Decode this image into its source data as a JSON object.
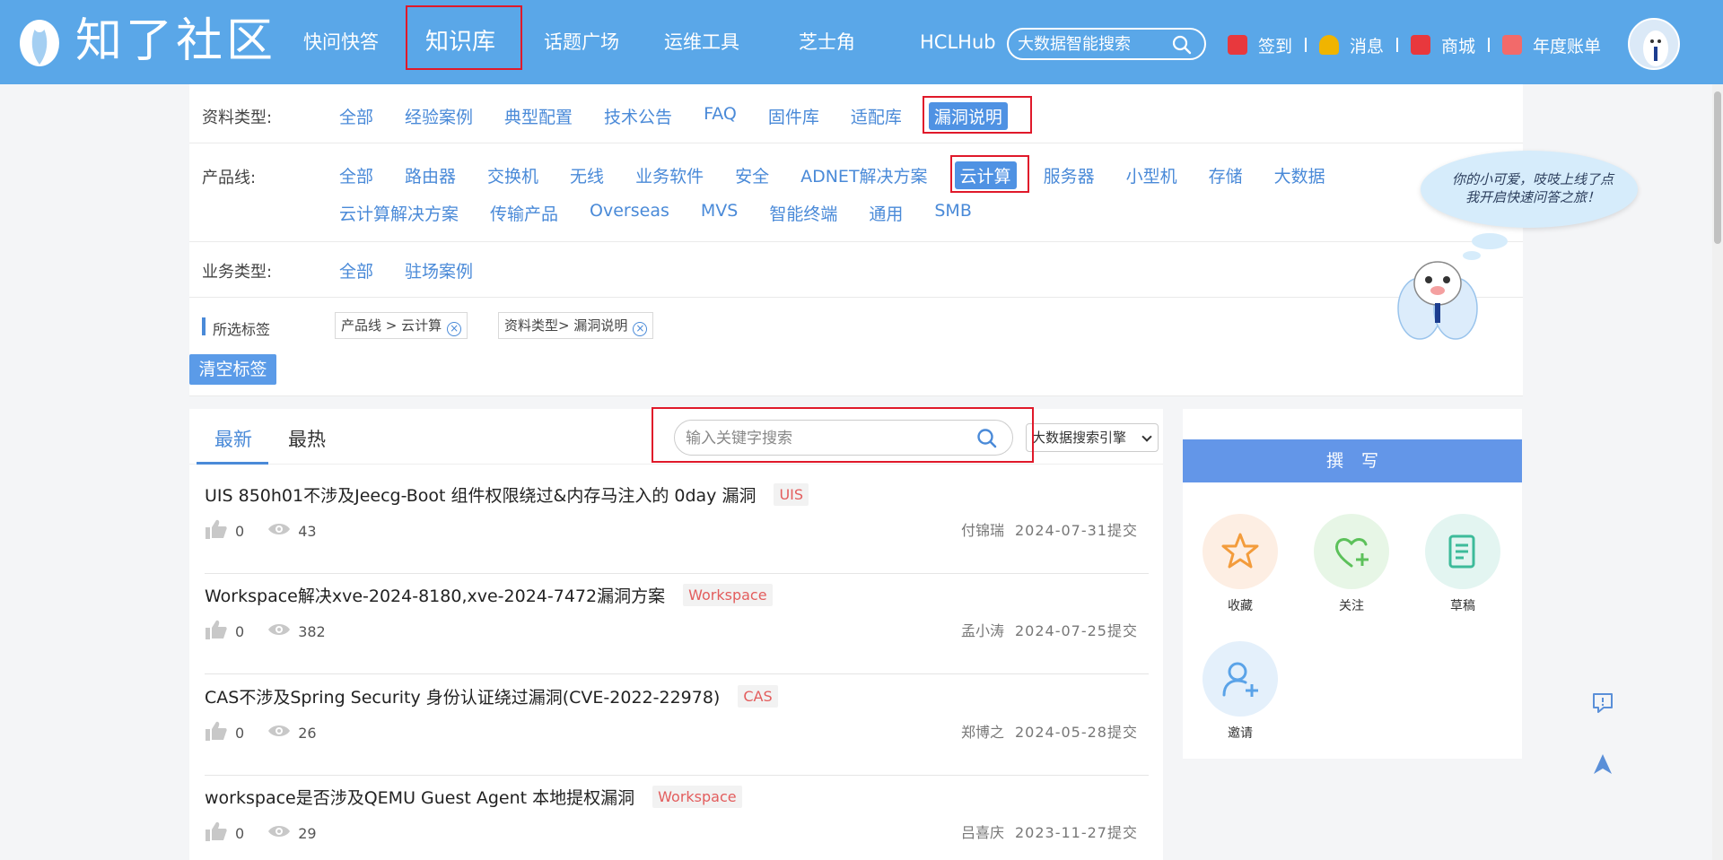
{
  "header": {
    "logo_text": "知了社区",
    "nav": [
      "快问快答",
      "知识库",
      "话题广场",
      "运维工具",
      "芝士角",
      "HCLHub"
    ],
    "search_placeholder": "大数据智能搜索",
    "links": [
      {
        "label": "签到",
        "icon": "gift-box-icon",
        "color": "#e8383d"
      },
      {
        "label": "消息",
        "icon": "bell-icon",
        "color": "#f0b400"
      },
      {
        "label": "商城",
        "icon": "gift-icon",
        "color": "#e8383d"
      },
      {
        "label": "年度账单",
        "icon": "bill-icon",
        "color": "#f26a6a"
      }
    ]
  },
  "filters": {
    "type_label": "资料类型:",
    "type_options": [
      "全部",
      "经验案例",
      "典型配置",
      "技术公告",
      "FAQ",
      "固件库",
      "适配库",
      "漏洞说明"
    ],
    "product_label": "产品线:",
    "product_options_row1": [
      "全部",
      "路由器",
      "交换机",
      "无线",
      "业务软件",
      "安全",
      "ADNET解决方案",
      "云计算",
      "服务器",
      "小型机",
      "存储",
      "大数据"
    ],
    "product_options_row2": [
      "云计算解决方案",
      "传输产品",
      "Overseas",
      "MVS",
      "智能终端",
      "通用",
      "SMB"
    ],
    "business_label": "业务类型:",
    "business_options": [
      "全部",
      "驻场案例"
    ],
    "selected_label": "所选标签",
    "selected_tags": [
      "产品线 >  云计算",
      "资料类型>  漏洞说明"
    ],
    "clear_label": "清空标签"
  },
  "mascot": {
    "bubble_text": "你的小可爱，吱吱上线了点我开启快速问答之旅！"
  },
  "main": {
    "tabs": [
      "最新",
      "最热"
    ],
    "search_placeholder": "输入关键字搜索",
    "engine": "大数据搜索引擎",
    "articles": [
      {
        "title": "UIS 850h01不涉及Jeecg-Boot 组件权限绕过&内存马注入的 0day 漏洞",
        "tag": "UIS",
        "likes": "0",
        "views": "43",
        "author": "付锦瑞",
        "date": "2024-07-31提交"
      },
      {
        "title": "Workspace解决xve-2024-8180,xve-2024-7472漏洞方案",
        "tag": "Workspace",
        "likes": "0",
        "views": "382",
        "author": "孟小涛",
        "date": "2024-07-25提交"
      },
      {
        "title": "CAS不涉及Spring Security 身份认证绕过漏洞(CVE-2022-22978)",
        "tag": "CAS",
        "likes": "0",
        "views": "26",
        "author": "郑博之",
        "date": "2024-05-28提交"
      },
      {
        "title": "workspace是否涉及QEMU Guest Agent 本地提权漏洞",
        "tag": "Workspace",
        "likes": "0",
        "views": "29",
        "author": "吕喜庆",
        "date": "2023-11-27提交"
      }
    ]
  },
  "sidebar": {
    "write_label": "撰写",
    "actions": [
      {
        "label": "收藏",
        "icon": "star-icon",
        "bg": "#fdeee3",
        "color": "#f39c3c"
      },
      {
        "label": "关注",
        "icon": "heart-plus-icon",
        "bg": "#e7f6e6",
        "color": "#5cc15a"
      },
      {
        "label": "草稿",
        "icon": "draft-icon",
        "bg": "#e3f5f1",
        "color": "#3dbb9a"
      },
      {
        "label": "邀请",
        "icon": "invite-user-icon",
        "bg": "#e4f0fb",
        "color": "#5aa3e8"
      }
    ]
  }
}
